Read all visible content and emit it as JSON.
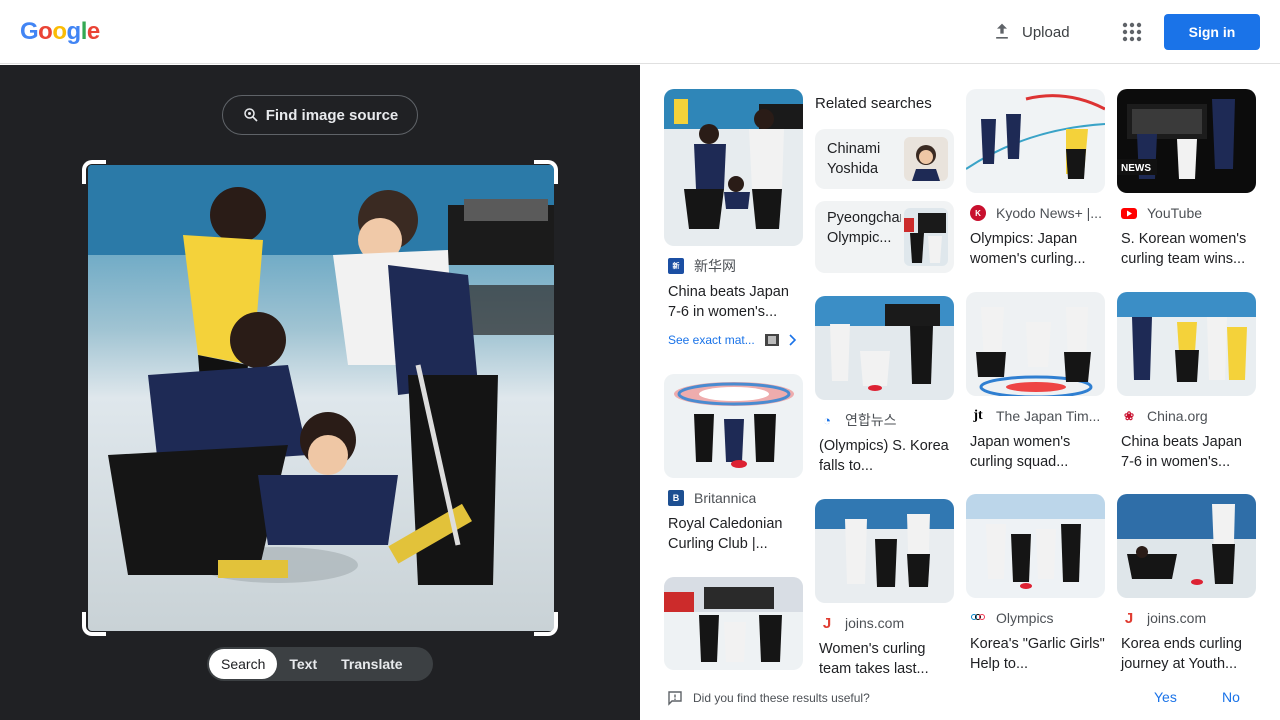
{
  "header": {
    "logo_letters": [
      "G",
      "o",
      "o",
      "g",
      "l",
      "e"
    ],
    "logo_colors": [
      "#4285f4",
      "#ea4335",
      "#fbbc05",
      "#4285f4",
      "#34a853",
      "#ea4335"
    ],
    "upload_label": "Upload",
    "signin_label": "Sign in"
  },
  "left": {
    "find_label": "Find image source",
    "tabs": [
      "Search",
      "Text",
      "Translate"
    ],
    "active_tab": "Search"
  },
  "related": {
    "title": "Related searches",
    "items": [
      {
        "label": "Chinami Yoshida"
      },
      {
        "label": "Pyeongchang Olympic..."
      }
    ]
  },
  "results": [
    {
      "source": "新华网",
      "title": "China beats Japan 7-6 in women's...",
      "favicon": "xinhua-icon"
    },
    {
      "source": "Britannica",
      "title": "Royal Caledonian Curling Club |...",
      "favicon": "britannica-icon"
    },
    {
      "source": "연합뉴스",
      "title": "(Olympics) S. Korea falls to...",
      "favicon": "yonhap-icon"
    },
    {
      "source": "joins.com",
      "title": "Women's curling team takes last...",
      "favicon": "joins-icon"
    },
    {
      "source": "Kyodo News+ |...",
      "title": "Olympics: Japan women's curling...",
      "favicon": "kyodo-icon"
    },
    {
      "source": "The Japan Tim...",
      "title": "Japan women's curling squad...",
      "favicon": "japan-times-icon"
    },
    {
      "source": "Olympics",
      "title": "Korea's \"Garlic Girls\" Help to...",
      "favicon": "olympics-icon"
    },
    {
      "source": "YouTube",
      "title": "S. Korean women's curling team wins...",
      "favicon": "youtube-icon"
    },
    {
      "source": "China.org",
      "title": "China beats Japan 7-6 in women's...",
      "favicon": "china-org-icon"
    },
    {
      "source": "joins.com",
      "title": "Korea ends curling journey at Youth...",
      "favicon": "joins-icon"
    }
  ],
  "exact_matches_label": "See exact mat...",
  "news_badge": "NEWS",
  "feedback": {
    "question": "Did you find these results useful?",
    "yes": "Yes",
    "no": "No"
  },
  "colors": {
    "brand_blue": "#1a73e8",
    "left_panel": "#202124"
  }
}
